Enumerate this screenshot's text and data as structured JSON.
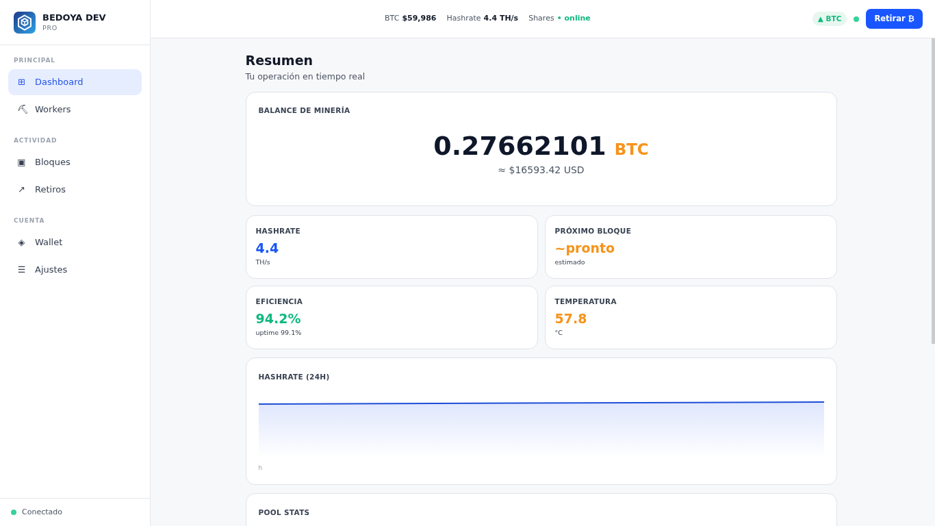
{
  "brand": {
    "name": "BEDOYA DEV",
    "tier": "PRO"
  },
  "sidebar": {
    "sections": [
      {
        "title": "PRINCIPAL",
        "items": [
          {
            "icon": "⊞",
            "label": "Dashboard",
            "selected": true
          },
          {
            "icon": "⛏",
            "label": "Workers",
            "selected": false
          }
        ]
      },
      {
        "title": "ACTIVIDAD",
        "items": [
          {
            "icon": "▣",
            "label": "Bloques",
            "selected": false
          },
          {
            "icon": "↗",
            "label": "Retiros",
            "selected": false
          }
        ]
      },
      {
        "title": "CUENTA",
        "items": [
          {
            "icon": "◈",
            "label": "Wallet",
            "selected": false
          },
          {
            "icon": "☰",
            "label": "Ajustes",
            "selected": false
          }
        ]
      }
    ],
    "status": {
      "label": "Conectado",
      "online": true
    }
  },
  "topbar": {
    "ticker": [
      {
        "label": "BTC",
        "value": "$59,986",
        "kind": "value"
      },
      {
        "label": "Hashrate",
        "value": "4.4 TH/s",
        "kind": "value"
      },
      {
        "label": "Shares",
        "value": "• online",
        "kind": "status"
      }
    ],
    "trend_badge": "▲ BTC",
    "online": true,
    "withdraw_button": "Retirar ₿"
  },
  "page": {
    "title": "Resumen",
    "subtitle": "Tu operación en tiempo real"
  },
  "balance": {
    "title": "BALANCE DE MINERÍA",
    "amount": "0.27662101",
    "unit": "BTC",
    "fiat": "≈ $16593.42 USD"
  },
  "stats": [
    {
      "label": "HASHRATE",
      "value": "4.4",
      "unit": "TH/s",
      "color": "#1a56f5"
    },
    {
      "label": "PRÓXIMO BLOQUE",
      "value": "~pronto",
      "unit": "estimado",
      "color": "#f7931a"
    },
    {
      "label": "EFICIENCIA",
      "value": "94.2%",
      "unit": "uptime 99.1%",
      "color": "#10b981"
    },
    {
      "label": "TEMPERATURA",
      "value": "57.8",
      "unit": "°C",
      "color": "#f7931a"
    }
  ],
  "hashrate_chart": {
    "title": "HASHRATE (24H)",
    "axis_label": "h"
  },
  "pool_stats": {
    "title": "POOL STATS"
  }
}
